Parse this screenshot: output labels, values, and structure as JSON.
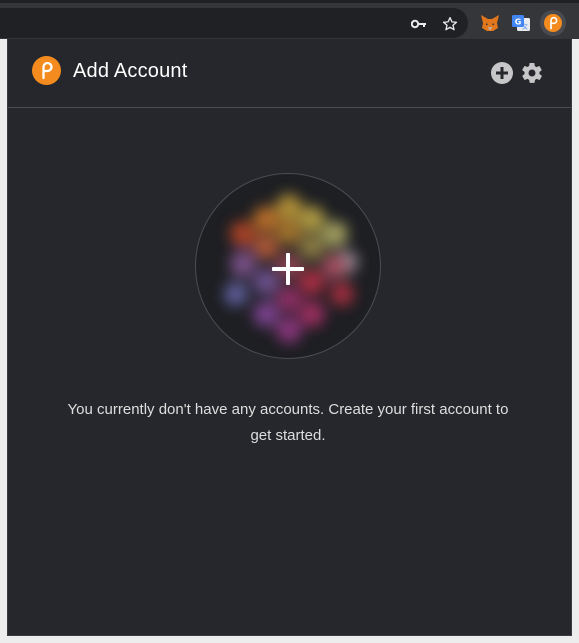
{
  "browser": {
    "icons": {
      "key": "key-icon",
      "bookmark": "star-icon",
      "metamask": "fox-icon",
      "translate": "translate-icon",
      "polkadot": "polkadot-icon"
    }
  },
  "popup": {
    "title": "Add Account",
    "icons": {
      "add": "plus-circle-icon",
      "settings": "gear-icon"
    },
    "identicon": {
      "icon": "plus-icon"
    },
    "empty_message": "You currently don't have any accounts. Create your first account to get started."
  },
  "colors": {
    "background": "#26272c",
    "accent": "#f38b1e",
    "text": "#ffffff",
    "muted_icon": "#c7c7c9"
  }
}
